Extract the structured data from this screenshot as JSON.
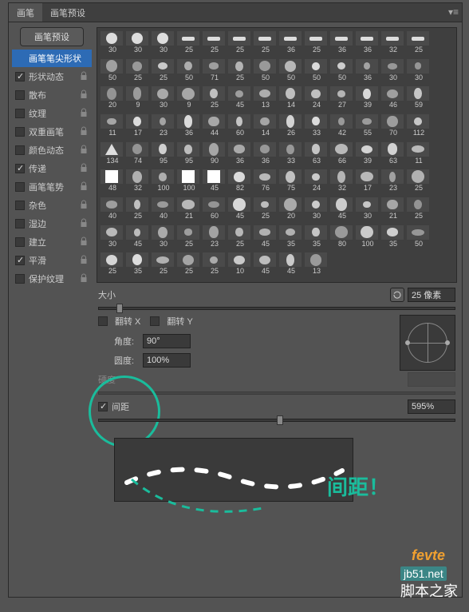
{
  "tabs": {
    "brush": "画笔",
    "presets": "画笔预设"
  },
  "sidebar": {
    "preset_btn": "画笔预设",
    "items": [
      {
        "label": "画笔笔尖形状",
        "checked": null,
        "selected": true,
        "lock": false
      },
      {
        "label": "形状动态",
        "checked": true,
        "lock": true
      },
      {
        "label": "散布",
        "checked": false,
        "lock": true
      },
      {
        "label": "纹理",
        "checked": false,
        "lock": true
      },
      {
        "label": "双重画笔",
        "checked": false,
        "lock": true
      },
      {
        "label": "颜色动态",
        "checked": false,
        "lock": true
      },
      {
        "label": "传递",
        "checked": true,
        "lock": true
      },
      {
        "label": "画笔笔势",
        "checked": false,
        "lock": true
      },
      {
        "label": "杂色",
        "checked": false,
        "lock": true
      },
      {
        "label": "湿边",
        "checked": false,
        "lock": true
      },
      {
        "label": "建立",
        "checked": false,
        "lock": true
      },
      {
        "label": "平滑",
        "checked": true,
        "lock": true
      },
      {
        "label": "保护纹理",
        "checked": false,
        "lock": true
      }
    ]
  },
  "thumbs": [
    "30",
    "30",
    "30",
    "25",
    "25",
    "25",
    "25",
    "36",
    "25",
    "36",
    "36",
    "32",
    "25",
    "50",
    "25",
    "25",
    "50",
    "71",
    "25",
    "50",
    "50",
    "50",
    "50",
    "36",
    "30",
    "30",
    "20",
    "9",
    "30",
    "9",
    "25",
    "45",
    "13",
    "14",
    "24",
    "27",
    "39",
    "46",
    "59",
    "11",
    "17",
    "23",
    "36",
    "44",
    "60",
    "14",
    "26",
    "33",
    "42",
    "55",
    "70",
    "112",
    "134",
    "74",
    "95",
    "95",
    "90",
    "36",
    "36",
    "33",
    "63",
    "66",
    "39",
    "63",
    "11",
    "48",
    "32",
    "100",
    "100",
    "45",
    "82",
    "76",
    "75",
    "24",
    "32",
    "17",
    "23",
    "25",
    "40",
    "25",
    "40",
    "21",
    "60",
    "45",
    "25",
    "20",
    "30",
    "45",
    "30",
    "21",
    "25",
    "30",
    "45",
    "30",
    "25",
    "23",
    "25",
    "45",
    "35",
    "35",
    "80",
    "100",
    "35",
    "50",
    "25",
    "35",
    "25",
    "25",
    "25",
    "10",
    "45",
    "45",
    "13"
  ],
  "controls": {
    "size_label": "大小",
    "size_value": "25 像素",
    "flip_x": "翻转 X",
    "flip_y": "翻转 Y",
    "angle_label": "角度:",
    "angle_value": "90°",
    "roundness_label": "圆度:",
    "roundness_value": "100%",
    "hardness_label": "硬度",
    "spacing_label": "间距",
    "spacing_value": "595%"
  },
  "annotation": "间距！",
  "watermark1": "fevte",
  "watermark2_prefix": "jb51.net",
  "watermark2_main": "脚本之家"
}
